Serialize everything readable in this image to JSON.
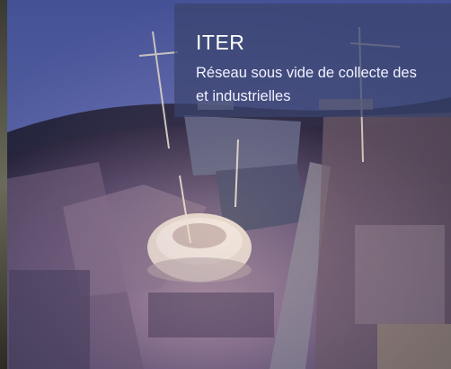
{
  "slide": {
    "image_alt": "Vue aérienne nocturne du chantier ITER",
    "caption": {
      "title": "ITER",
      "subtitle_line1": "Réseau sous vide de collecte des",
      "subtitle_line2": "et industrielles"
    }
  },
  "colors": {
    "caption_overlay": "#3a446e",
    "caption_text": "#ffffff"
  }
}
